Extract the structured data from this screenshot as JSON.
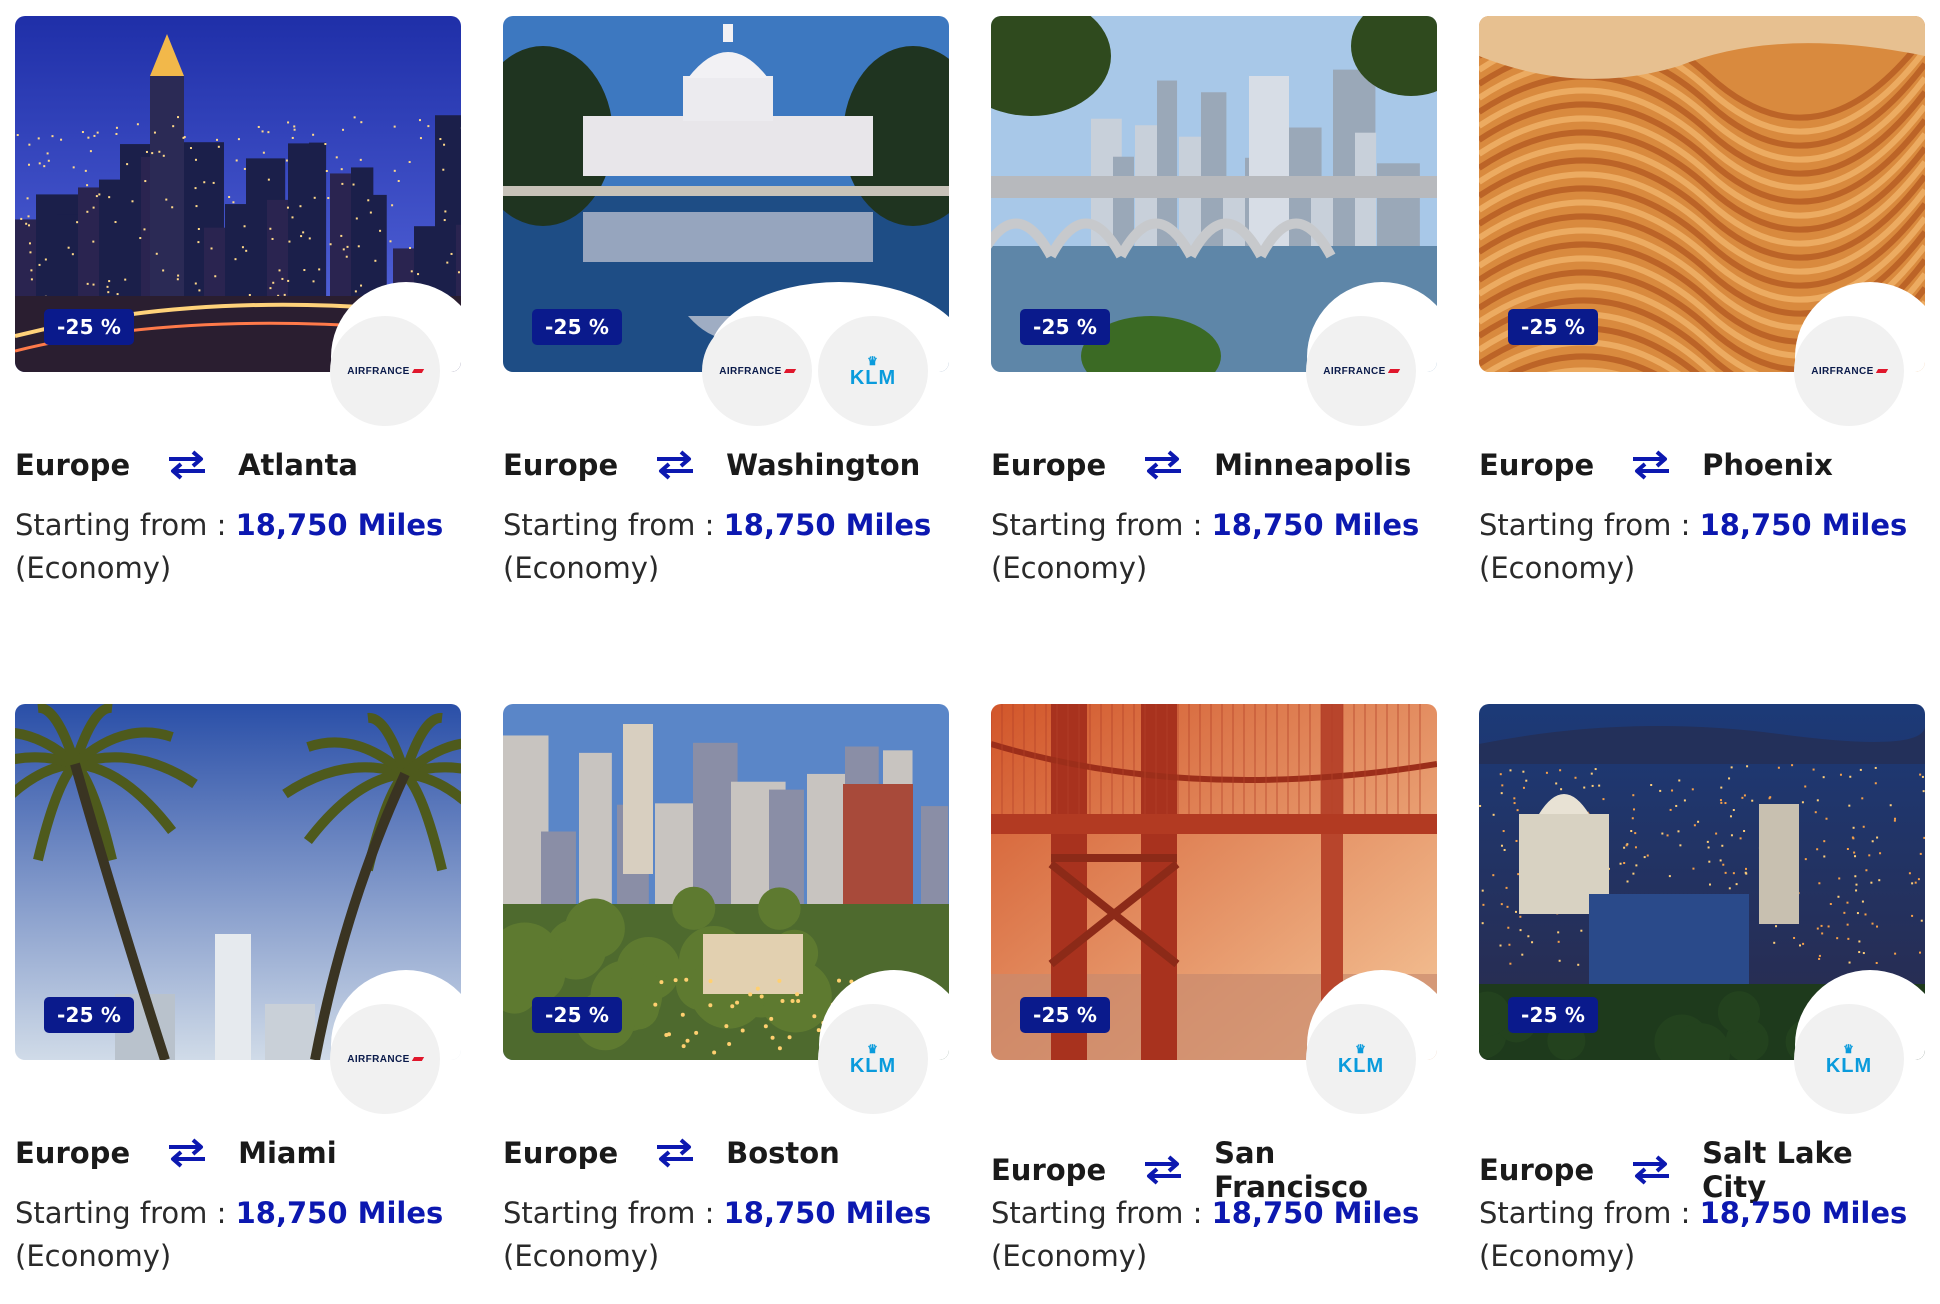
{
  "offers": [
    {
      "origin": "Europe",
      "destination": "Atlanta",
      "discount": "-25 %",
      "price_prefix": "Starting from : ",
      "price": "18,750 Miles",
      "cabin": "(Economy)",
      "airlines": [
        "airfrance"
      ],
      "scene": "atlanta"
    },
    {
      "origin": "Europe",
      "destination": "Washington",
      "discount": "-25 %",
      "price_prefix": "Starting from : ",
      "price": "18,750 Miles",
      "cabin": "(Economy)",
      "airlines": [
        "airfrance",
        "klm"
      ],
      "scene": "washington"
    },
    {
      "origin": "Europe",
      "destination": "Minneapolis",
      "discount": "-25 %",
      "price_prefix": "Starting from : ",
      "price": "18,750 Miles",
      "cabin": "(Economy)",
      "airlines": [
        "airfrance"
      ],
      "scene": "minneapolis"
    },
    {
      "origin": "Europe",
      "destination": "Phoenix",
      "discount": "-25 %",
      "price_prefix": "Starting from : ",
      "price": "18,750 Miles",
      "cabin": "(Economy)",
      "airlines": [
        "airfrance"
      ],
      "scene": "phoenix"
    },
    {
      "origin": "Europe",
      "destination": "Miami",
      "discount": "-25 %",
      "price_prefix": "Starting from : ",
      "price": "18,750 Miles",
      "cabin": "(Economy)",
      "airlines": [
        "airfrance"
      ],
      "scene": "miami"
    },
    {
      "origin": "Europe",
      "destination": "Boston",
      "discount": "-25 %",
      "price_prefix": "Starting from : ",
      "price": "18,750 Miles",
      "cabin": "(Economy)",
      "airlines": [
        "klm"
      ],
      "scene": "boston"
    },
    {
      "origin": "Europe",
      "destination": "San Francisco",
      "discount": "-25 %",
      "price_prefix": "Starting from : ",
      "price": "18,750 Miles",
      "cabin": "(Economy)",
      "airlines": [
        "klm"
      ],
      "scene": "sanfrancisco"
    },
    {
      "origin": "Europe",
      "destination": "Salt Lake City",
      "discount": "-25 %",
      "price_prefix": "Starting from : ",
      "price": "18,750 Miles",
      "cabin": "(Economy)",
      "airlines": [
        "klm"
      ],
      "scene": "saltlake"
    }
  ],
  "airline_logos": {
    "airfrance": {
      "text": "AIRFRANCE"
    },
    "klm": {
      "text": "KLM"
    }
  },
  "colors": {
    "badge_bg": "#0a1a8c",
    "miles_text": "#0c18b0",
    "arrows": "#0c18b0",
    "klm_blue": "#0a9bdc",
    "airfrance_red": "#e0172c"
  }
}
